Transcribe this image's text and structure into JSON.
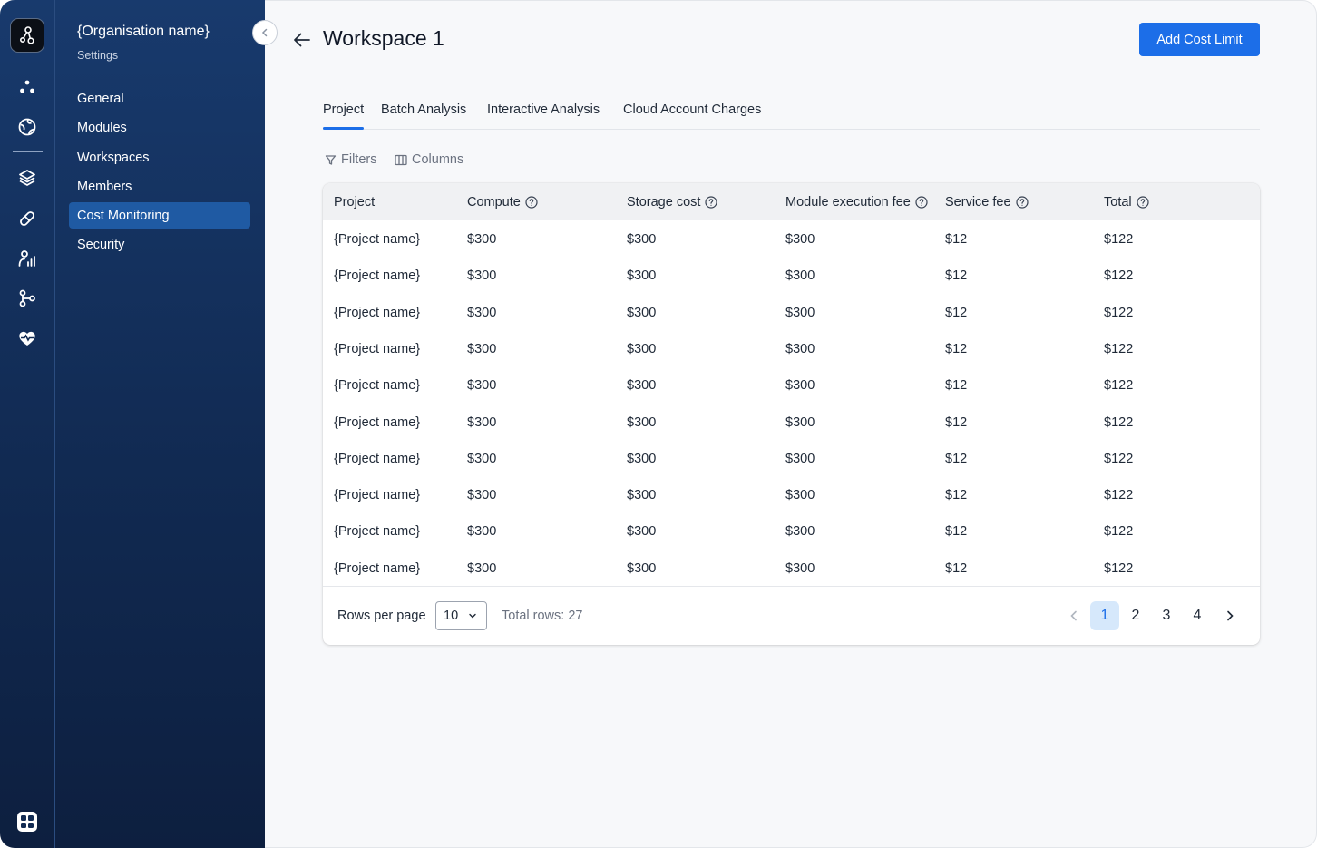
{
  "org": {
    "name": "{Organisation name}",
    "subtitle": "Settings"
  },
  "rail": {
    "icons": [
      "logo-icon",
      "dots-icon",
      "globe-icon",
      "layers-icon",
      "pill-icon",
      "person-chart-icon",
      "branch-icon",
      "heart-pulse-icon",
      "apps-icon"
    ]
  },
  "nav": {
    "items": [
      {
        "label": "General"
      },
      {
        "label": "Modules"
      },
      {
        "label": "Workspaces"
      },
      {
        "label": "Members"
      },
      {
        "label": "Cost Monitoring",
        "active": true
      },
      {
        "label": "Security"
      }
    ]
  },
  "header": {
    "title": "Workspace 1",
    "action_label": "Add Cost Limit"
  },
  "tabs": [
    {
      "label": "Project",
      "active": true
    },
    {
      "label": "Batch Analysis"
    },
    {
      "label": "Interactive Analysis"
    },
    {
      "label": "Cloud Account Charges"
    }
  ],
  "toolbar": {
    "filters_label": "Filters",
    "columns_label": "Columns"
  },
  "table": {
    "columns": [
      "Project",
      "Compute",
      "Storage cost",
      "Module execution fee",
      "Service fee",
      "Total"
    ],
    "rows": [
      [
        "{Project name}",
        "$300",
        "$300",
        "$300",
        "$12",
        "$122"
      ],
      [
        "{Project name}",
        "$300",
        "$300",
        "$300",
        "$12",
        "$122"
      ],
      [
        "{Project name}",
        "$300",
        "$300",
        "$300",
        "$12",
        "$122"
      ],
      [
        "{Project name}",
        "$300",
        "$300",
        "$300",
        "$12",
        "$122"
      ],
      [
        "{Project name}",
        "$300",
        "$300",
        "$300",
        "$12",
        "$122"
      ],
      [
        "{Project name}",
        "$300",
        "$300",
        "$300",
        "$12",
        "$122"
      ],
      [
        "{Project name}",
        "$300",
        "$300",
        "$300",
        "$12",
        "$122"
      ],
      [
        "{Project name}",
        "$300",
        "$300",
        "$300",
        "$12",
        "$122"
      ],
      [
        "{Project name}",
        "$300",
        "$300",
        "$300",
        "$12",
        "$122"
      ],
      [
        "{Project name}",
        "$300",
        "$300",
        "$300",
        "$12",
        "$122"
      ]
    ]
  },
  "pagination": {
    "rows_per_page_label": "Rows per page",
    "rows_per_page_value": "10",
    "total_rows_text": "Total rows: 27",
    "pages": [
      "1",
      "2",
      "3",
      "4"
    ],
    "current_page": "1"
  },
  "colors": {
    "accent": "#1c6ee8",
    "sidebar": "#112a52",
    "active_nav": "#1f5aa3",
    "page_active_bg": "#d6e8fb"
  }
}
